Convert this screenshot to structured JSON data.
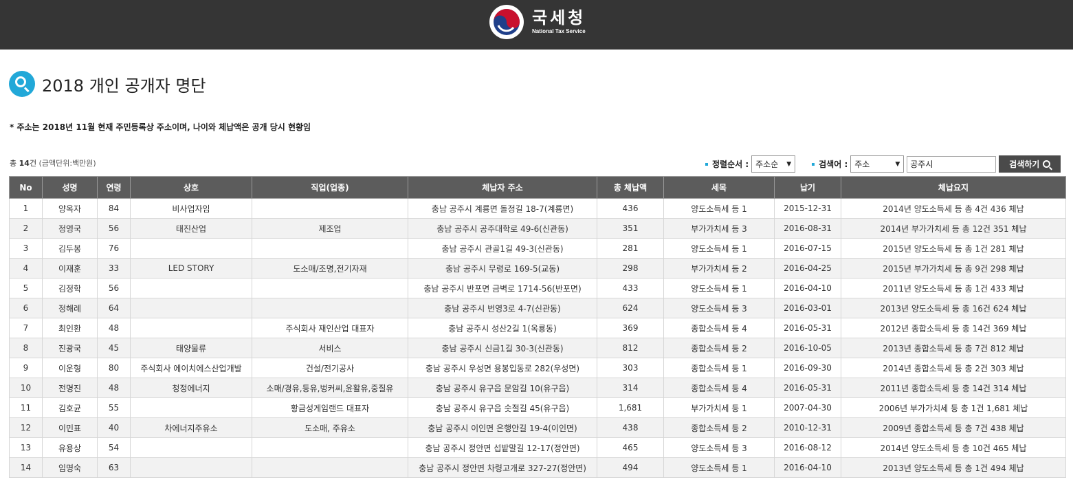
{
  "header": {
    "logo_ko": "국세청",
    "logo_en": "National Tax Service"
  },
  "page": {
    "title": "2018 개인 공개자 명단",
    "notice": "* 주소는 2018년 11월 현재 주민등록상 주소이며, 나이와 체납액은 공개 당시 현황임"
  },
  "summary": {
    "prefix": "총 ",
    "count": "14",
    "suffix": "건",
    "unit": " (금액단위:백만원)"
  },
  "controls": {
    "sort_label": "정렬순서 :",
    "sort_value": "주소순",
    "search_label": "검색어 :",
    "search_field": "주소",
    "search_query": "공주시",
    "search_button": "검색하기"
  },
  "colors": {
    "header_bg": "#353535",
    "accent": "#22a8d8",
    "table_header_bg": "#5c5c5c"
  },
  "table": {
    "headers": [
      "No",
      "성명",
      "연령",
      "상호",
      "직업(업종)",
      "체납자 주소",
      "총 체납액",
      "세목",
      "납기",
      "체납요지"
    ],
    "rows": [
      [
        "1",
        "양옥자",
        "84",
        "비사업자임",
        "",
        "충남 공주시 계룡면 돌정길 18-7(계룡면)",
        "436",
        "양도소득세 등 1",
        "2015-12-31",
        "2014년 양도소득세 등 총 4건 436 체납"
      ],
      [
        "2",
        "정영국",
        "56",
        "태진산업",
        "제조업",
        "충남 공주시 공주대학로 49-6(신관동)",
        "351",
        "부가가치세 등 3",
        "2016-08-31",
        "2014년 부가가치세 등 총 12건 351 체납"
      ],
      [
        "3",
        "김두봉",
        "76",
        "",
        "",
        "충남 공주시 관골1길 49-3(신관동)",
        "281",
        "양도소득세 등 1",
        "2016-07-15",
        "2015년 양도소득세 등 총 1건 281 체납"
      ],
      [
        "4",
        "이재훈",
        "33",
        "LED STORY",
        "도소매/조명,전기자재",
        "충남 공주시 무령로 169-5(교동)",
        "298",
        "부가가치세 등 2",
        "2016-04-25",
        "2015년 부가가치세 등 총 9건 298 체납"
      ],
      [
        "5",
        "김정학",
        "56",
        "",
        "",
        "충남 공주시 반포면 금벽로 1714-56(반포면)",
        "433",
        "양도소득세 등 1",
        "2016-04-10",
        "2011년 양도소득세 등 총 1건 433 체납"
      ],
      [
        "6",
        "정해례",
        "64",
        "",
        "",
        "충남 공주시 번영3로 4-7(신관동)",
        "624",
        "양도소득세 등 3",
        "2016-03-01",
        "2013년 양도소득세 등 총 16건 624 체납"
      ],
      [
        "7",
        "최인환",
        "48",
        "",
        "주식회사 재인산업 대표자",
        "충남 공주시 성산2길 1(옥룡동)",
        "369",
        "종합소득세 등 4",
        "2016-05-31",
        "2012년 종합소득세 등 총 14건 369 체납"
      ],
      [
        "8",
        "진광국",
        "45",
        "태양물류",
        "서비스",
        "충남 공주시 신금1길 30-3(신관동)",
        "812",
        "종합소득세 등 2",
        "2016-10-05",
        "2013년 종합소득세 등 총 7건 812 체납"
      ],
      [
        "9",
        "이운형",
        "80",
        "주식회사 에이치에스산업개발",
        "건설/전기공사",
        "충남 공주시 우성면 용봉입동로 282(우성면)",
        "303",
        "종합소득세 등 1",
        "2016-09-30",
        "2014년 종합소득세 등 총 2건 303 체납"
      ],
      [
        "10",
        "전명진",
        "48",
        "청정에너지",
        "소매/경유,등유,벙커씨,윤활유,중질유",
        "충남 공주시 유구읍 문암길 10(유구읍)",
        "314",
        "종합소득세 등 4",
        "2016-05-31",
        "2011년 종합소득세 등 총 14건 314 체납"
      ],
      [
        "11",
        "김호균",
        "55",
        "",
        "황금성게임랜드 대표자",
        "충남 공주시 유구읍 숫절길 45(유구읍)",
        "1,681",
        "부가가치세 등 1",
        "2007-04-30",
        "2006년 부가가치세 등 총 1건 1,681 체납"
      ],
      [
        "12",
        "이민표",
        "40",
        "차에너지주유소",
        "도소매, 주유소",
        "충남 공주시 이인면 은행안길 19-4(이인면)",
        "438",
        "종합소득세 등 2",
        "2010-12-31",
        "2009년 종합소득세 등 총 7건 438 체납"
      ],
      [
        "13",
        "유용상",
        "54",
        "",
        "",
        "충남 공주시 정안면 섭밭말길 12-17(정안면)",
        "465",
        "양도소득세 등 3",
        "2016-08-12",
        "2014년 양도소득세 등 총 10건 465 체납"
      ],
      [
        "14",
        "임명숙",
        "63",
        "",
        "",
        "충남 공주시 정안면 차령고개로 327-27(정안면)",
        "494",
        "양도소득세 등 1",
        "2016-04-10",
        "2013년 양도소득세 등 총 1건 494 체납"
      ]
    ]
  }
}
